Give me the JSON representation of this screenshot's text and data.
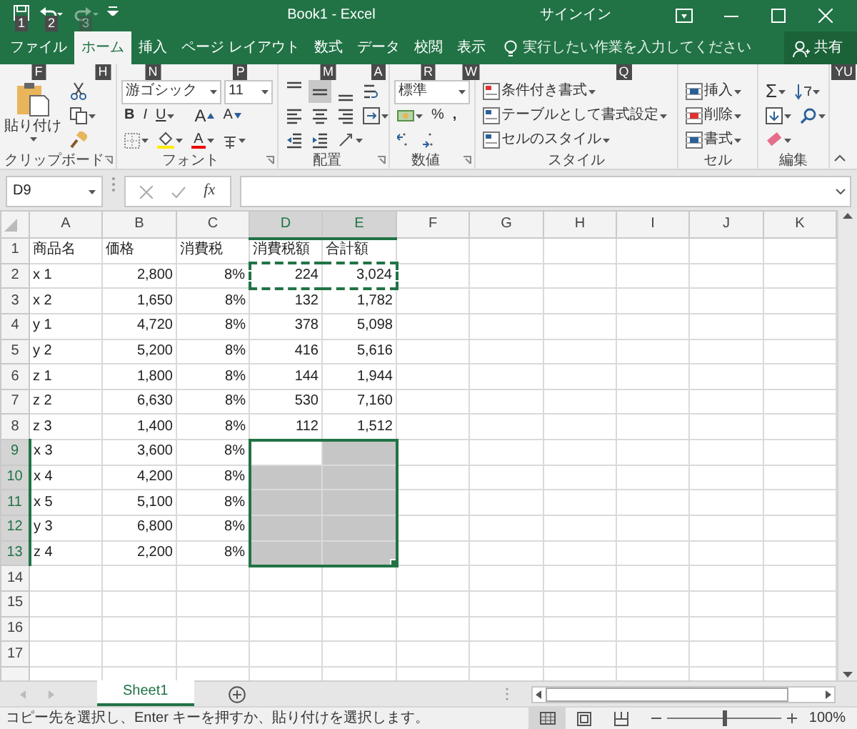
{
  "title_bar": {
    "quick_access": [
      {
        "kind": "save",
        "keytip": "1",
        "disabled": false
      },
      {
        "kind": "undo",
        "keytip": "2",
        "disabled": false
      },
      {
        "kind": "redo",
        "keytip": "3",
        "disabled": true
      }
    ],
    "title": "Book1 - Excel",
    "sign_in": "サインイン"
  },
  "tabs": [
    {
      "label": "ファイル",
      "keytip": "F",
      "selected": false
    },
    {
      "label": "ホーム",
      "keytip": "H",
      "selected": true
    },
    {
      "label": "挿入",
      "keytip": "N",
      "selected": false
    },
    {
      "label": "ページ レイアウト",
      "keytip": "P",
      "selected": false
    },
    {
      "label": "数式",
      "keytip": "M",
      "selected": false
    },
    {
      "label": "データ",
      "keytip": "A",
      "selected": false
    },
    {
      "label": "校閲",
      "keytip": "R",
      "selected": false
    },
    {
      "label": "表示",
      "keytip": "W",
      "selected": false
    }
  ],
  "tell_me": {
    "placeholder": "実行したい作業を入力してください",
    "keytip": "Q"
  },
  "share": {
    "label": "共有",
    "keytip": "YU"
  },
  "ribbon": {
    "clipboard": {
      "paste": "貼り付け",
      "label": "クリップボード"
    },
    "font": {
      "name": "游ゴシック",
      "size": "11",
      "bold": "B",
      "italic": "I",
      "underline": "U",
      "grow": "A",
      "shrink": "A",
      "color_letter": "A",
      "label": "フォント"
    },
    "alignment": {
      "vertical": [
        {
          "kind": "top",
          "selected": false
        },
        {
          "kind": "middle",
          "selected": true
        },
        {
          "kind": "bottom",
          "selected": false
        }
      ],
      "label": "配置"
    },
    "number": {
      "format": "標準",
      "percent": "%",
      "comma": ",",
      "label": "数値"
    },
    "styles": {
      "items": [
        "条件付き書式",
        "テーブルとして書式設定",
        "セルのスタイル"
      ],
      "label": "スタイル"
    },
    "cells": {
      "items": [
        "挿入",
        "削除",
        "書式"
      ],
      "label": "セル"
    },
    "editing": {
      "autosum": "Σ",
      "label": "編集"
    }
  },
  "formula_bar": {
    "name_box": "D9",
    "function_label": "fx"
  },
  "grid": {
    "columns": [
      {
        "label": "A",
        "selected": false
      },
      {
        "label": "B",
        "selected": false
      },
      {
        "label": "C",
        "selected": false
      },
      {
        "label": "D",
        "selected": true
      },
      {
        "label": "E",
        "selected": true
      },
      {
        "label": "F",
        "selected": false
      },
      {
        "label": "G",
        "selected": false
      },
      {
        "label": "H",
        "selected": false
      },
      {
        "label": "I",
        "selected": false
      },
      {
        "label": "J",
        "selected": false
      },
      {
        "label": "K",
        "selected": false
      }
    ],
    "rows": [
      {
        "label": "1",
        "selected": false,
        "copied": false,
        "cells": [
          "商品名",
          "価格",
          "消費税",
          "消費税額",
          "合計額"
        ]
      },
      {
        "label": "2",
        "selected": false,
        "copied": true,
        "cells": [
          "x 1",
          "2,800",
          "8%",
          "224",
          "3,024"
        ]
      },
      {
        "label": "3",
        "selected": false,
        "copied": false,
        "cells": [
          "x 2",
          "1,650",
          "8%",
          "132",
          "1,782"
        ]
      },
      {
        "label": "4",
        "selected": false,
        "copied": false,
        "cells": [
          "y 1",
          "4,720",
          "8%",
          "378",
          "5,098"
        ]
      },
      {
        "label": "5",
        "selected": false,
        "copied": false,
        "cells": [
          "y 2",
          "5,200",
          "8%",
          "416",
          "5,616"
        ]
      },
      {
        "label": "6",
        "selected": false,
        "copied": false,
        "cells": [
          "z 1",
          "1,800",
          "8%",
          "144",
          "1,944"
        ]
      },
      {
        "label": "7",
        "selected": false,
        "copied": false,
        "cells": [
          "z 2",
          "6,630",
          "8%",
          "530",
          "7,160"
        ]
      },
      {
        "label": "8",
        "selected": false,
        "copied": false,
        "cells": [
          "z 3",
          "1,400",
          "8%",
          "112",
          "1,512"
        ]
      },
      {
        "label": "9",
        "selected": true,
        "copied": false,
        "cells": [
          "x 3",
          "3,600",
          "8%"
        ]
      },
      {
        "label": "10",
        "selected": true,
        "copied": false,
        "cells": [
          "x 4",
          "4,200",
          "8%"
        ]
      },
      {
        "label": "11",
        "selected": true,
        "copied": false,
        "cells": [
          "x 5",
          "5,100",
          "8%"
        ]
      },
      {
        "label": "12",
        "selected": true,
        "copied": false,
        "cells": [
          "y 3",
          "6,800",
          "8%"
        ]
      },
      {
        "label": "13",
        "selected": true,
        "copied": false,
        "cells": [
          "z 4",
          "2,200",
          "8%"
        ]
      },
      {
        "label": "14",
        "selected": false,
        "copied": false
      },
      {
        "label": "15",
        "selected": false,
        "copied": false
      },
      {
        "label": "16",
        "selected": false,
        "copied": false
      },
      {
        "label": "17",
        "selected": false,
        "copied": false
      }
    ]
  },
  "sheet_tabs": [
    {
      "label": "Sheet1",
      "selected": true
    }
  ],
  "status_bar": {
    "message": "コピー先を選択し、Enter キーを押すか、貼り付けを選択します。",
    "zoom_slider": {
      "level": 0.5
    },
    "zoom": "100%"
  }
}
